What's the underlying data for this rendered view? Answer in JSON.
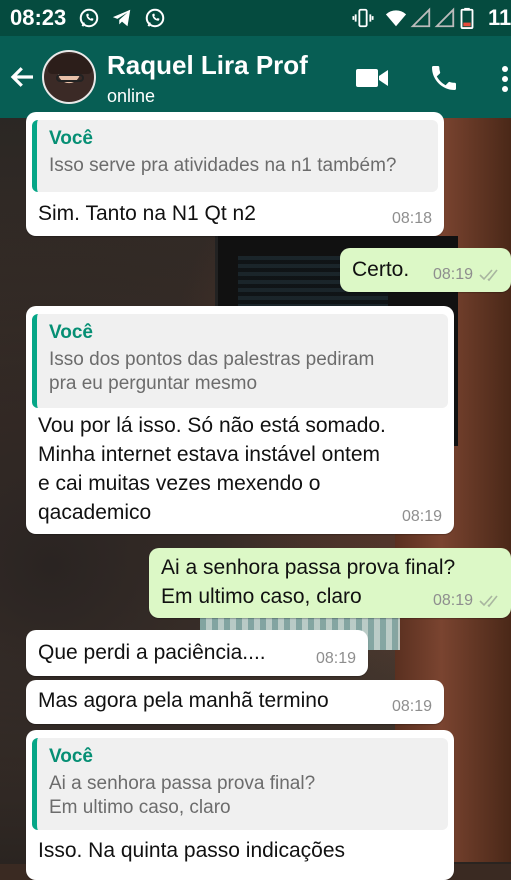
{
  "status_bar": {
    "time": "08:23",
    "battery_text": "11",
    "icons": [
      "whatsapp-icon",
      "telegram-icon",
      "whatsapp-icon",
      "vibrate-icon",
      "wifi-icon",
      "signal-icon",
      "signal-icon",
      "battery-icon"
    ]
  },
  "header": {
    "contact_name": "Raquel Lira Prof",
    "contact_status": "online",
    "icons": [
      "back-arrow-icon",
      "video-call-icon",
      "phone-call-icon",
      "more-options-icon"
    ]
  },
  "messages": [
    {
      "direction": "in",
      "quote_author": "Você",
      "quote_text": "Isso serve pra atividades na n1 também?",
      "text": "Sim. Tanto na N1 Qt n2",
      "time": "08:18"
    },
    {
      "direction": "out",
      "text": "Certo.",
      "time": "08:19",
      "read": true
    },
    {
      "direction": "in",
      "quote_author": "Você",
      "quote_text": "Isso dos pontos das palestras pediram\npra eu perguntar mesmo",
      "text": "Vou por lá isso. Só não está somado.\nMinha internet estava instável ontem\ne cai muitas vezes mexendo o\nqacademico",
      "time": "08:19"
    },
    {
      "direction": "out",
      "text": "Ai a senhora passa prova final?\nEm ultimo caso, claro",
      "time": "08:19",
      "read": true
    },
    {
      "direction": "in",
      "text": "Que perdi a paciência....",
      "time": "08:19"
    },
    {
      "direction": "in",
      "text": "Mas agora pela manhã termino",
      "time": "08:19"
    },
    {
      "direction": "in",
      "quote_author": "Você",
      "quote_text": "Ai a senhora passa prova final?\nEm ultimo caso, claro",
      "text": "Isso. Na quinta passo indicações",
      "time": ""
    }
  ],
  "colors": {
    "header": "#075e54",
    "status_bar": "#054b3f",
    "incoming": "#ffffff",
    "outgoing": "#dcf8c6",
    "quote_accent": "#06a687"
  }
}
